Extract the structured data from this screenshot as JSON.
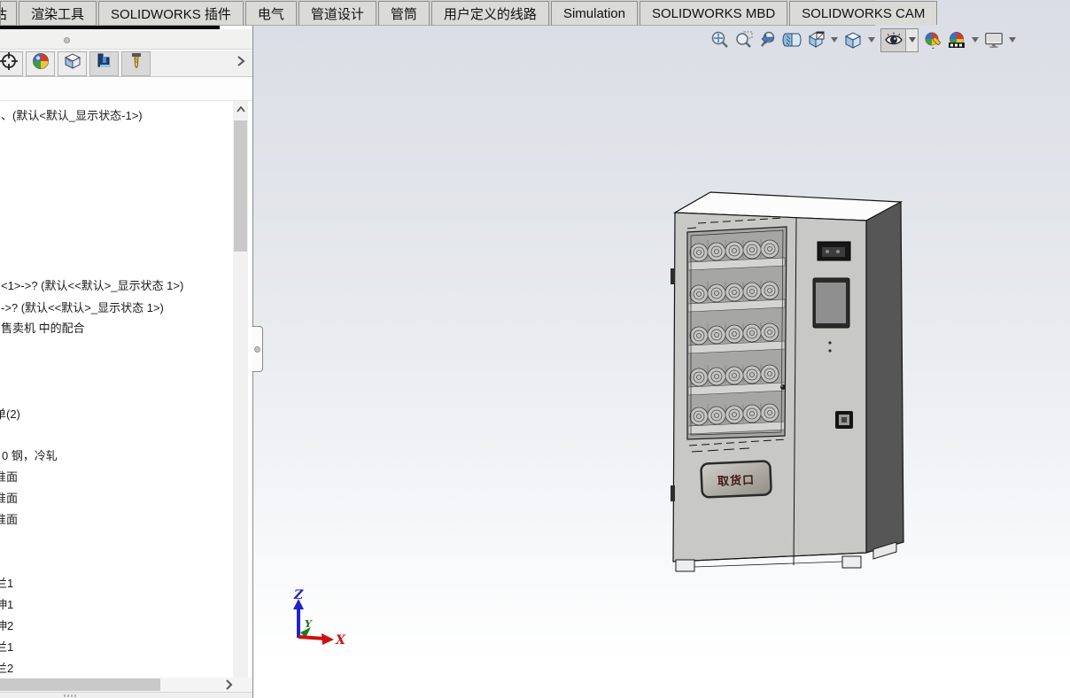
{
  "tab_bar": {
    "tabs": [
      "估",
      "渲染工具",
      "SOLIDWORKS 插件",
      "电气",
      "管道设计",
      "管筒",
      "用户定义的线路",
      "Simulation",
      "SOLIDWORKS MBD",
      "SOLIDWORKS CAM"
    ]
  },
  "panel": {
    "tab_icons": [
      "crosshair-icon",
      "appearance-ball-icon",
      "configuration-box-icon",
      "cam-machine-icon",
      "cam-tool-icon",
      "expand-chevron-icon"
    ],
    "tree_rows": [
      "、(默认<默认_显示状态-1>)",
      "<1>->? (默认<<默认>_显示状态 1>)",
      "->? (默认<<默认>_显示状态 1>)",
      "售卖机 中的配合",
      "单(2)",
      "0 钢，冷轧",
      "准面",
      "准面",
      "准面",
      "兰1",
      "伸1",
      "伸2",
      "兰1",
      "兰2"
    ]
  },
  "viewport": {
    "toolbar_icons": [
      "zoom-to-fit",
      "zoom-to-area",
      "previous-view",
      "section-view",
      "dynamic-annotation-views",
      "view-orientation",
      "hide-show-items",
      "edit-appearance",
      "apply-scene",
      "view-settings"
    ],
    "machine": {
      "pickup_label": "取货口"
    },
    "triad": {
      "x_label": "X",
      "y_label": "Y",
      "z_label": "Z"
    }
  },
  "colors": {
    "viewport_top": "#dadde5",
    "viewport_bottom": "#ffffff",
    "tab_bg": "#dadad7",
    "machine_front": "#c8c8c6",
    "machine_side": "#565656",
    "machine_top": "#fcfcfc",
    "pickup_text": "#401a12",
    "axis_x_red": "#cc1111",
    "axis_y_green": "#1a6b1a",
    "axis_z_blue": "#2222cc"
  }
}
